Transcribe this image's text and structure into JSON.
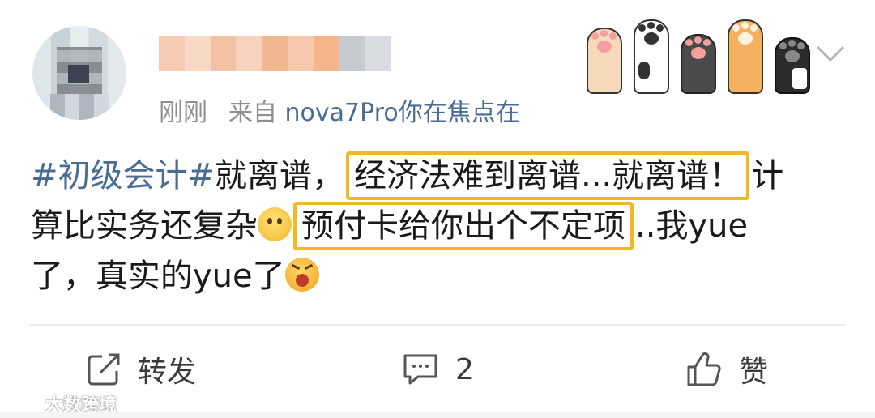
{
  "header": {
    "meta_time": "刚刚",
    "meta_source_prefix": "来自",
    "meta_source_device": "nova7Pro你在焦点在"
  },
  "post": {
    "line1_topic": "#初级会计#",
    "line1_text": "就离谱，",
    "line1_highlight": "经济法难到离谱...就离谱！",
    "line1_tail": "计",
    "line2_text": "算比实务还复杂",
    "line2_highlight": "预付卡给你出个不定项",
    "line2_tail": "..我yue",
    "line3_text": "了，真实的yue了"
  },
  "actions": {
    "share_label": "转发",
    "comment_count": "2",
    "like_label": "赞"
  },
  "watermark": {
    "text": "大数跨境"
  },
  "colors": {
    "accent_link": "#4a6b94",
    "highlight_border": "#f2b826",
    "meta_gray": "#8f8f8f"
  },
  "icons": [
    "share-icon",
    "comment-icon",
    "like-icon",
    "chevron-down-icon",
    "smile-emoji-icon",
    "yell-emoji-icon",
    "cat-paw-sticker-icon"
  ]
}
